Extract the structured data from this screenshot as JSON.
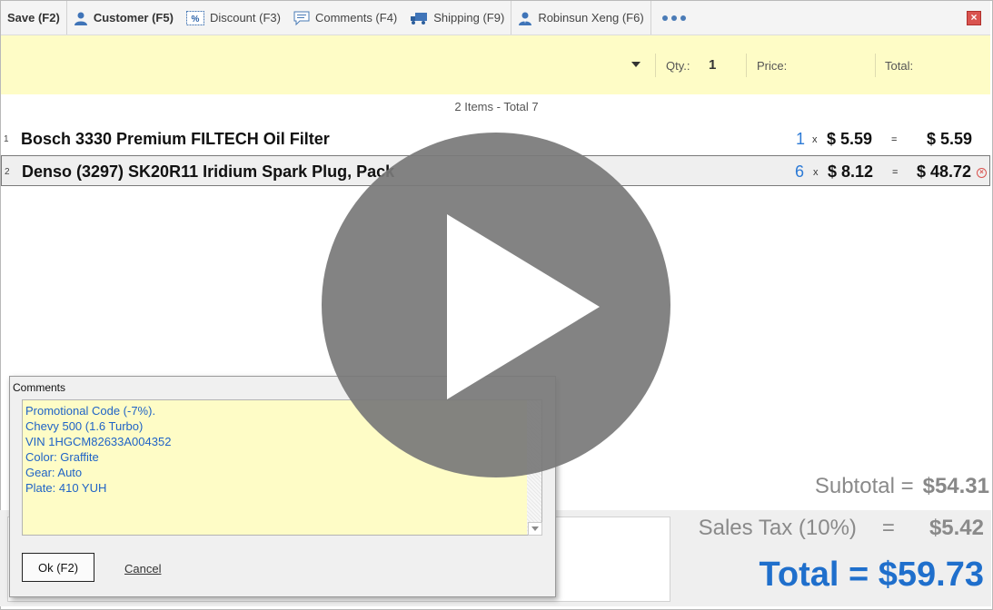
{
  "toolbar": {
    "save": "Save (F2)",
    "customer": "Customer (F5)",
    "discount": "Discount (F3)",
    "comments": "Comments (F4)",
    "shipping": "Shipping (F9)",
    "user": "Robinsun Xeng (F6)"
  },
  "entry": {
    "qty_label": "Qty.:",
    "qty_value": "1",
    "price_label": "Price:",
    "total_label": "Total:"
  },
  "summary": "2 Items - Total 7",
  "lines": [
    {
      "index": "1",
      "name": "Bosch 3330 Premium FILTECH Oil Filter",
      "qty": "1",
      "times": "x",
      "price": "$ 5.59",
      "eq": "=",
      "total": "$ 5.59"
    },
    {
      "index": "2",
      "name": "Denso (3297) SK20R11 Iridium Spark Plug, Pack",
      "qty": "6",
      "times": "x",
      "price": "$ 8.12",
      "eq": "=",
      "total": "$ 48.72"
    }
  ],
  "totals": {
    "subtotal_label": "Subtotal =",
    "subtotal_value": "$54.31",
    "tax_label": "Sales Tax (10%)",
    "tax_eq": "=",
    "tax_value": "$5.42",
    "grand": "Total = $59.73"
  },
  "comments_dialog": {
    "title": "Comments",
    "text": "Promotional Code (-7%).\nChevy 500 (1.6 Turbo)\nVIN 1HGCM82633A004352\nColor: Graffite\nGear: Auto\nPlate: 410 YUH",
    "ok": "Ok (F2)",
    "cancel": "Cancel"
  },
  "colors": {
    "accent": "#1f6fcc",
    "entry_bg": "#fefcc6",
    "close": "#d9534f"
  },
  "icons": [
    "save-icon",
    "customer-icon",
    "discount-icon",
    "comments-icon",
    "shipping-icon",
    "user-icon",
    "more-icon",
    "close-icon",
    "play-icon"
  ]
}
